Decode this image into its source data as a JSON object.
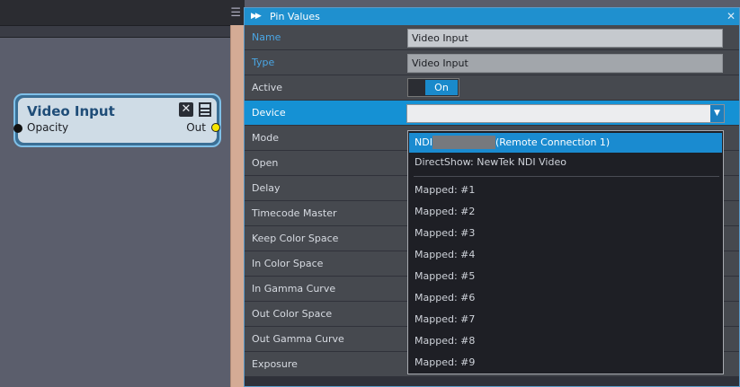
{
  "canvas": {
    "node": {
      "title": "Video Input",
      "close_glyph": "✕",
      "input_pin": "Opacity",
      "output_pin": "Out"
    },
    "menu_glyph": "☰"
  },
  "panel": {
    "title": "Pin Values",
    "arrows_glyph": "▶▶",
    "close_glyph": "✕",
    "rows": [
      {
        "label": "Name",
        "value": "Video Input"
      },
      {
        "label": "Type",
        "value": "Video Input"
      },
      {
        "label": "Active",
        "toggle": "On"
      },
      {
        "label": "Device",
        "value": ""
      },
      {
        "label": "Mode"
      },
      {
        "label": "Open"
      },
      {
        "label": "Delay"
      },
      {
        "label": "Timecode Master"
      },
      {
        "label": "Keep Color Space"
      },
      {
        "label": "In Color Space"
      },
      {
        "label": "In Gamma Curve"
      },
      {
        "label": "Out Color Space"
      },
      {
        "label": "Out Gamma Curve"
      },
      {
        "label": "Exposure"
      }
    ],
    "dropdown": {
      "arrow_glyph": "▼",
      "items": [
        {
          "prefix": "NDI",
          "suffix": "(Remote Connection 1)"
        },
        {
          "label": "DirectShow: NewTek NDI Video"
        },
        {
          "label": "Mapped: #1"
        },
        {
          "label": "Mapped: #2"
        },
        {
          "label": "Mapped: #3"
        },
        {
          "label": "Mapped: #4"
        },
        {
          "label": "Mapped: #5"
        },
        {
          "label": "Mapped: #6"
        },
        {
          "label": "Mapped: #7"
        },
        {
          "label": "Mapped: #8"
        },
        {
          "label": "Mapped: #9"
        }
      ]
    }
  },
  "colors": {
    "accent": "#1591d4",
    "node_border": "#7fc0e8",
    "out_pin": "#f5e400"
  }
}
